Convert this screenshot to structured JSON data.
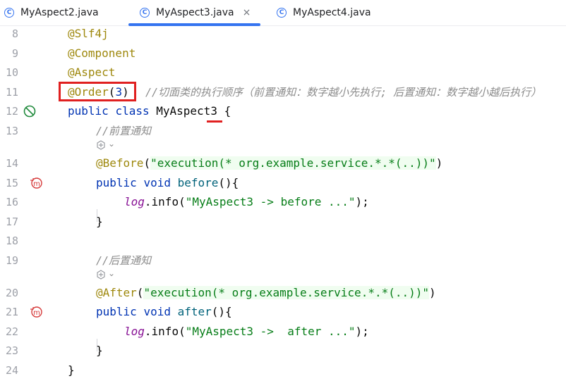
{
  "tabs": [
    {
      "label": "MyAspect2.java",
      "icon": "class-icon",
      "active": false
    },
    {
      "label": "MyAspect3.java",
      "icon": "class-icon",
      "active": true,
      "close": "×"
    },
    {
      "label": "MyAspect4.java",
      "icon": "class-icon",
      "active": false
    }
  ],
  "class_icon_glyph": "C",
  "lines": {
    "l8": {
      "num": "8",
      "ann": "@Slf4j"
    },
    "l9": {
      "num": "9",
      "ann": "@Component"
    },
    "l10": {
      "num": "10",
      "ann": "@Aspect"
    },
    "l11": {
      "num": "11",
      "ann": "@Order",
      "paren_open": "(",
      "value": "3",
      "paren_close": ")",
      "comment": "//切面类的执行顺序（前置通知：数字越小先执行; 后置通知：数字越小越后执行）"
    },
    "l12": {
      "num": "12",
      "kw1": "public",
      "kw2": "class",
      "name": "MyAspect3",
      "brace": "{"
    },
    "l13": {
      "num": "13",
      "comment": "//前置通知"
    },
    "l14": {
      "num": "14",
      "ann": "@Before",
      "open": "(",
      "string": "\"execution(* org.example.service.*.*(..))\"",
      "close": ")"
    },
    "l15": {
      "num": "15",
      "kw1": "public",
      "kw2": "void",
      "method": "before",
      "rest": "(){"
    },
    "l16": {
      "num": "16",
      "log": "log",
      "call": ".info(",
      "string": "\"MyAspect3 -> before ...\"",
      "end": ");"
    },
    "l17": {
      "num": "17",
      "brace": "}"
    },
    "l18": {
      "num": "18"
    },
    "l19": {
      "num": "19",
      "comment": "//后置通知"
    },
    "l20": {
      "num": "20",
      "ann": "@After",
      "open": "(",
      "string": "\"execution(* org.example.service.*.*(..))\"",
      "close": ")"
    },
    "l21": {
      "num": "21",
      "kw1": "public",
      "kw2": "void",
      "method": "after",
      "rest": "(){"
    },
    "l22": {
      "num": "22",
      "log": "log",
      "call": ".info(",
      "string": "\"MyAspect3 ->  after ...\"",
      "end": ");"
    },
    "l23": {
      "num": "23",
      "brace": "}"
    },
    "l24": {
      "num": "24",
      "brace": "}"
    }
  },
  "hint_glyph": "⌄",
  "colors": {
    "annotation": "#9e880d",
    "keyword": "#0033b3",
    "string": "#067d17",
    "comment": "#8c8c8c",
    "accent": "#3574f0",
    "highlight_box": "#e02020"
  }
}
